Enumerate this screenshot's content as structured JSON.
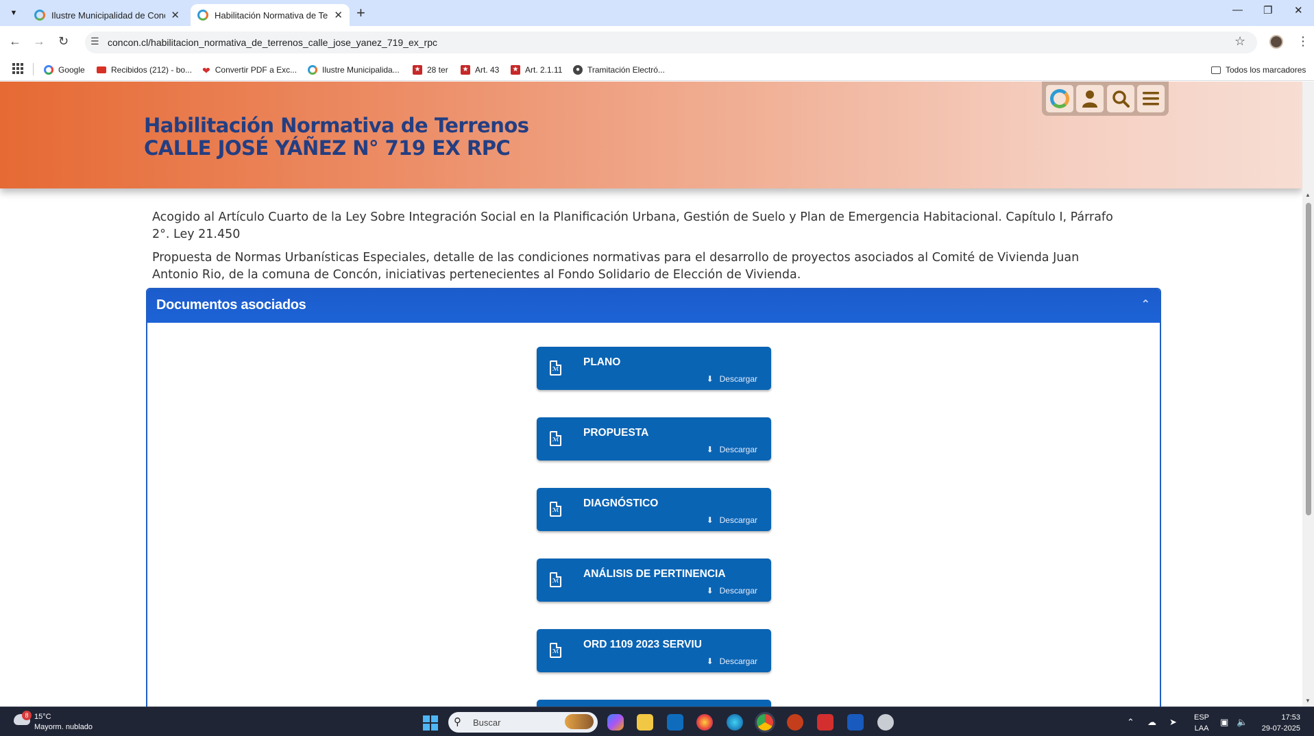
{
  "browser": {
    "tabs": [
      {
        "title": "Ilustre Municipalidad de Concó",
        "active": false
      },
      {
        "title": "Habilitación Normativa de Terre",
        "active": true
      }
    ],
    "url": "concon.cl/habilitacion_normativa_de_terrenos_calle_jose_yanez_719_ex_rpc",
    "bookmarks": [
      {
        "label": "Google",
        "icon": "google-icon",
        "color": "#4285f4"
      },
      {
        "label": "Recibidos (212) - bo...",
        "icon": "gmail-icon",
        "color": "#d93025"
      },
      {
        "label": "Convertir PDF a Exc...",
        "icon": "heart-icon",
        "color": "#d32f2f"
      },
      {
        "label": "Ilustre Municipalida...",
        "icon": "concon-icon",
        "color": "#2e9bd6"
      },
      {
        "label": "28 ter",
        "icon": "bookmark-star-icon",
        "color": "#c62828"
      },
      {
        "label": "Art. 43",
        "icon": "bookmark-star-icon",
        "color": "#c62828"
      },
      {
        "label": "Art. 2.1.11",
        "icon": "bookmark-star-icon",
        "color": "#c62828"
      },
      {
        "label": "Tramitación Electró...",
        "icon": "globe-icon",
        "color": "#444444"
      }
    ],
    "all_bookmarks": "Todos los marcadores"
  },
  "page": {
    "title_line1": "Habilitación Normativa de Terrenos",
    "title_line2": "CALLE JOSÉ YÁÑEZ N° 719 EX RPC",
    "intro_p1": "Acogido al Artículo Cuarto de la Ley Sobre Integración Social en la Planificación Urbana, Gestión de Suelo y Plan de Emergencia Habitacional. Capítulo I, Párrafo 2°. Ley 21.450",
    "intro_p2": "Propuesta de Normas Urbanísticas Especiales, detalle de las condiciones normativas para el desarrollo de proyectos asociados al Comité de Vivienda Juan Antonio Rio, de la comuna de Concón, iniciativas pertenecientes al Fondo Solidario de Elección de Vivienda.",
    "panel_title": "Documentos asociados",
    "download_label": "Descargar",
    "documents": [
      {
        "name": "PLANO"
      },
      {
        "name": "PROPUESTA"
      },
      {
        "name": "DIAGNÓSTICO"
      },
      {
        "name": "ANÁLISIS DE PERTINENCIA"
      },
      {
        "name": "ORD 1109 2023 SERVIU"
      },
      {
        "name": ""
      }
    ],
    "accent_color": "#0a64b4",
    "header_text_color": "#243e82"
  },
  "taskbar": {
    "weather_temp": "15°C",
    "weather_desc": "Mayorm. nublado",
    "weather_badge": "8",
    "search_placeholder": "Buscar",
    "lang_line1": "ESP",
    "lang_line2": "LAA",
    "time": "17:53",
    "date": "29-07-2025"
  }
}
